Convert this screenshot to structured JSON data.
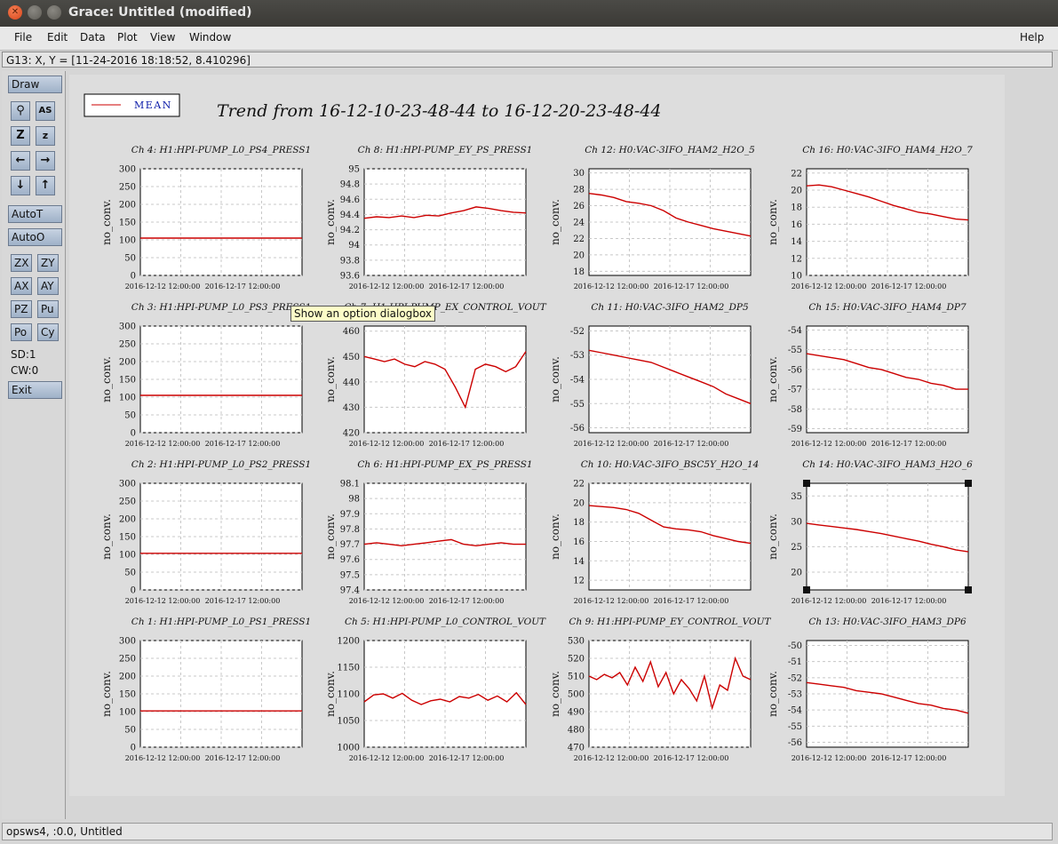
{
  "window": {
    "title": "Grace: Untitled (modified)"
  },
  "menubar": {
    "items": [
      "File",
      "Edit",
      "Data",
      "Plot",
      "View",
      "Window"
    ],
    "help": "Help"
  },
  "locator": {
    "text": "G13: X, Y = [11-24-2016 18:18:52, 8.410296]"
  },
  "toolbar": {
    "draw": "Draw",
    "autot": "AutoT",
    "autoo": "AutoO",
    "zoom_buttons": [
      "ZX",
      "ZY",
      "AX",
      "AY",
      "PZ",
      "Pu",
      "Po",
      "Cy"
    ],
    "sd": "SD:1",
    "cw": "CW:0",
    "exit": "Exit",
    "icons": [
      "magnify-icon",
      "autoscale-text-icon",
      "zoom-z-icon",
      "zoom-z-small-icon",
      "arrow-left-icon",
      "arrow-right-icon",
      "arrow-down-icon",
      "arrow-up-icon"
    ]
  },
  "tooltip": {
    "text": "Show an option dialogbox"
  },
  "status": {
    "text": "opsws4, :0.0, Untitled"
  },
  "legend": {
    "label": "MEAN",
    "color": "#cc0000"
  },
  "figure_title": "Trend from 16-12-10-23-48-44 to 16-12-20-23-48-44",
  "chart_data": [
    {
      "type": "line",
      "title": "Ch 4: H1:HPI-PUMP_L0_PS4_PRESS1",
      "ylabel": "no_conv.",
      "xticks": [
        "2016-12-12 12:00:00",
        "2016-12-17 12:00:00"
      ],
      "yticks": [
        "0",
        "50",
        "100",
        "150",
        "200",
        "250",
        "300"
      ],
      "ylim": [
        0,
        300
      ],
      "series": [
        {
          "name": "MEAN",
          "values": [
            105,
            105,
            105,
            105,
            105,
            105,
            105,
            105,
            105,
            105
          ]
        }
      ]
    },
    {
      "type": "line",
      "title": "Ch 8: H1:HPI-PUMP_EY_PS_PRESS1",
      "ylabel": "no_conv.",
      "xticks": [
        "2016-12-12 12:00:00",
        "2016-12-17 12:00:00"
      ],
      "yticks": [
        "93.6",
        "93.8",
        "94",
        "94.2",
        "94.4",
        "94.6",
        "94.8",
        "95"
      ],
      "ylim": [
        93.6,
        95
      ],
      "series": [
        {
          "name": "MEAN",
          "values": [
            94.35,
            94.37,
            94.36,
            94.38,
            94.36,
            94.39,
            94.38,
            94.42,
            94.45,
            94.5,
            94.48,
            94.45,
            94.43,
            94.42
          ]
        }
      ]
    },
    {
      "type": "line",
      "title": "Ch 12: H0:VAC-3IFO_HAM2_H2O_5",
      "ylabel": "no_conv.",
      "xticks": [
        "2016-12-12 12:00:00",
        "2016-12-17 12:00:00"
      ],
      "yticks": [
        "18",
        "20",
        "22",
        "24",
        "26",
        "28",
        "30"
      ],
      "ylim": [
        17.5,
        30.5
      ],
      "series": [
        {
          "name": "MEAN",
          "values": [
            27.5,
            27.3,
            27,
            26.5,
            26.3,
            26,
            25.4,
            24.5,
            24,
            23.6,
            23.2,
            22.9,
            22.6,
            22.3
          ]
        }
      ]
    },
    {
      "type": "line",
      "title": "Ch 16: H0:VAC-3IFO_HAM4_H2O_7",
      "ylabel": "no_conv.",
      "xticks": [
        "2016-12-12 12:00:00",
        "2016-12-17 12:00:00"
      ],
      "yticks": [
        "10",
        "12",
        "14",
        "16",
        "18",
        "20",
        "22"
      ],
      "ylim": [
        10,
        22.5
      ],
      "series": [
        {
          "name": "MEAN",
          "values": [
            20.5,
            20.6,
            20.4,
            20,
            19.6,
            19.2,
            18.7,
            18.2,
            17.8,
            17.4,
            17.2,
            16.9,
            16.6,
            16.5
          ]
        }
      ]
    },
    {
      "type": "line",
      "title": "Ch 3: H1:HPI-PUMP_L0_PS3_PRESS1",
      "ylabel": "no_conv.",
      "xticks": [
        "2016-12-12 12:00:00",
        "2016-12-17 12:00:00"
      ],
      "yticks": [
        "0",
        "50",
        "100",
        "150",
        "200",
        "250",
        "300"
      ],
      "ylim": [
        0,
        300
      ],
      "series": [
        {
          "name": "MEAN",
          "values": [
            105,
            105,
            105,
            105,
            105,
            105,
            105,
            105,
            105,
            105
          ]
        }
      ]
    },
    {
      "type": "line",
      "title": "Ch 7: H1:HPI-PUMP_EX_CONTROL_VOUT",
      "ylabel": "no_conv.",
      "xticks": [
        "2016-12-12 12:00:00",
        "2016-12-17 12:00:00"
      ],
      "yticks": [
        "420",
        "430",
        "440",
        "450",
        "460"
      ],
      "ylim": [
        420,
        462
      ],
      "series": [
        {
          "name": "MEAN",
          "values": [
            450,
            449,
            448,
            449,
            447,
            446,
            448,
            447,
            445,
            438,
            430,
            445,
            447,
            446,
            444,
            446,
            452
          ]
        }
      ]
    },
    {
      "type": "line",
      "title": "Ch 11: H0:VAC-3IFO_HAM2_DP5",
      "ylabel": "no_conv.",
      "xticks": [
        "2016-12-12 12:00:00",
        "2016-12-17 12:00:00"
      ],
      "yticks": [
        "-56",
        "-55",
        "-54",
        "-53",
        "-52"
      ],
      "ylim": [
        -56.2,
        -51.8
      ],
      "series": [
        {
          "name": "MEAN",
          "values": [
            -52.8,
            -52.9,
            -53,
            -53.1,
            -53.2,
            -53.3,
            -53.5,
            -53.7,
            -53.9,
            -54.1,
            -54.3,
            -54.6,
            -54.8,
            -55
          ]
        }
      ]
    },
    {
      "type": "line",
      "title": "Ch 15: H0:VAC-3IFO_HAM4_DP7",
      "ylabel": "no_conv.",
      "xticks": [
        "2016-12-12 12:00:00",
        "2016-12-17 12:00:00"
      ],
      "yticks": [
        "-59",
        "-58",
        "-57",
        "-56",
        "-55",
        "-54"
      ],
      "ylim": [
        -59.2,
        -53.8
      ],
      "series": [
        {
          "name": "MEAN",
          "values": [
            -55.2,
            -55.3,
            -55.4,
            -55.5,
            -55.7,
            -55.9,
            -56,
            -56.2,
            -56.4,
            -56.5,
            -56.7,
            -56.8,
            -57,
            -57
          ]
        }
      ]
    },
    {
      "type": "line",
      "title": "Ch 2: H1:HPI-PUMP_L0_PS2_PRESS1",
      "ylabel": "no_conv.",
      "xticks": [
        "2016-12-12 12:00:00",
        "2016-12-17 12:00:00"
      ],
      "yticks": [
        "0",
        "50",
        "100",
        "150",
        "200",
        "250",
        "300"
      ],
      "ylim": [
        0,
        300
      ],
      "series": [
        {
          "name": "MEAN",
          "values": [
            103,
            103,
            103,
            103,
            103,
            103,
            103,
            103,
            103,
            103
          ]
        }
      ]
    },
    {
      "type": "line",
      "title": "Ch 6: H1:HPI-PUMP_EX_PS_PRESS1",
      "ylabel": "no_conv.",
      "xticks": [
        "2016-12-12 12:00:00",
        "2016-12-17 12:00:00"
      ],
      "yticks": [
        "97.4",
        "97.5",
        "97.6",
        "97.7",
        "97.8",
        "97.9",
        "98",
        "98.1"
      ],
      "ylim": [
        97.4,
        98.1
      ],
      "series": [
        {
          "name": "MEAN",
          "values": [
            97.7,
            97.71,
            97.7,
            97.69,
            97.7,
            97.71,
            97.72,
            97.73,
            97.7,
            97.69,
            97.7,
            97.71,
            97.7,
            97.7
          ]
        }
      ]
    },
    {
      "type": "line",
      "title": "Ch 10: H0:VAC-3IFO_BSC5Y_H2O_14",
      "ylabel": "no_conv.",
      "xticks": [
        "2016-12-12 12:00:00",
        "2016-12-17 12:00:00"
      ],
      "yticks": [
        "12",
        "14",
        "16",
        "18",
        "20",
        "22"
      ],
      "ylim": [
        11,
        22
      ],
      "series": [
        {
          "name": "MEAN",
          "values": [
            19.7,
            19.6,
            19.5,
            19.3,
            18.9,
            18.2,
            17.5,
            17.3,
            17.2,
            17,
            16.6,
            16.3,
            16,
            15.8
          ]
        }
      ]
    },
    {
      "type": "line",
      "title": "Ch 14: H0:VAC-3IFO_HAM3_H2O_6",
      "ylabel": "no_conv.",
      "xticks": [
        "2016-12-12 12:00:00",
        "2016-12-17 12:00:00"
      ],
      "yticks": [
        "20",
        "25",
        "30",
        "35"
      ],
      "ylim": [
        16.5,
        37.5
      ],
      "series": [
        {
          "name": "MEAN",
          "values": [
            29.6,
            29.3,
            29,
            28.7,
            28.4,
            28,
            27.6,
            27.1,
            26.6,
            26.1,
            25.5,
            25,
            24.4,
            24
          ]
        }
      ]
    },
    {
      "type": "line",
      "title": "Ch 1: H1:HPI-PUMP_L0_PS1_PRESS1",
      "ylabel": "no_conv.",
      "xticks": [
        "2016-12-12 12:00:00",
        "2016-12-17 12:00:00"
      ],
      "yticks": [
        "0",
        "50",
        "100",
        "150",
        "200",
        "250",
        "300"
      ],
      "ylim": [
        0,
        300
      ],
      "series": [
        {
          "name": "MEAN",
          "values": [
            102,
            102,
            102,
            102,
            102,
            102,
            102,
            102,
            102,
            102
          ]
        }
      ]
    },
    {
      "type": "line",
      "title": "Ch 5: H1:HPI-PUMP_L0_CONTROL_VOUT",
      "ylabel": "no_conv.",
      "xticks": [
        "2016-12-12 12:00:00",
        "2016-12-17 12:00:00"
      ],
      "yticks": [
        "1000",
        "1050",
        "1100",
        "1150",
        "1200"
      ],
      "ylim": [
        1000,
        1200
      ],
      "series": [
        {
          "name": "MEAN",
          "values": [
            1085,
            1098,
            1100,
            1092,
            1101,
            1088,
            1080,
            1087,
            1090,
            1085,
            1095,
            1092,
            1099,
            1088,
            1096,
            1085,
            1102,
            1080
          ]
        }
      ]
    },
    {
      "type": "line",
      "title": "Ch 9: H1:HPI-PUMP_EY_CONTROL_VOUT",
      "ylabel": "no_conv.",
      "xticks": [
        "2016-12-12 12:00:00",
        "2016-12-17 12:00:00"
      ],
      "yticks": [
        "470",
        "480",
        "490",
        "500",
        "510",
        "520",
        "530"
      ],
      "ylim": [
        470,
        530
      ],
      "series": [
        {
          "name": "MEAN",
          "values": [
            510,
            508,
            511,
            509,
            512,
            505,
            515,
            507,
            518,
            504,
            512,
            500,
            508,
            503,
            496,
            510,
            492,
            505,
            502,
            520,
            510,
            508
          ]
        }
      ]
    },
    {
      "type": "line",
      "title": "Ch 13: H0:VAC-3IFO_HAM3_DP6",
      "ylabel": "no_conv.",
      "xticks": [
        "2016-12-12 12:00:00",
        "2016-12-17 12:00:00"
      ],
      "yticks": [
        "-56",
        "-55",
        "-54",
        "-53",
        "-52",
        "-51",
        "-50"
      ],
      "ylim": [
        -56.3,
        -49.7
      ],
      "series": [
        {
          "name": "MEAN",
          "values": [
            -52.3,
            -52.4,
            -52.5,
            -52.6,
            -52.8,
            -52.9,
            -53,
            -53.2,
            -53.4,
            -53.6,
            -53.7,
            -53.9,
            -54,
            -54.2
          ]
        }
      ]
    }
  ]
}
